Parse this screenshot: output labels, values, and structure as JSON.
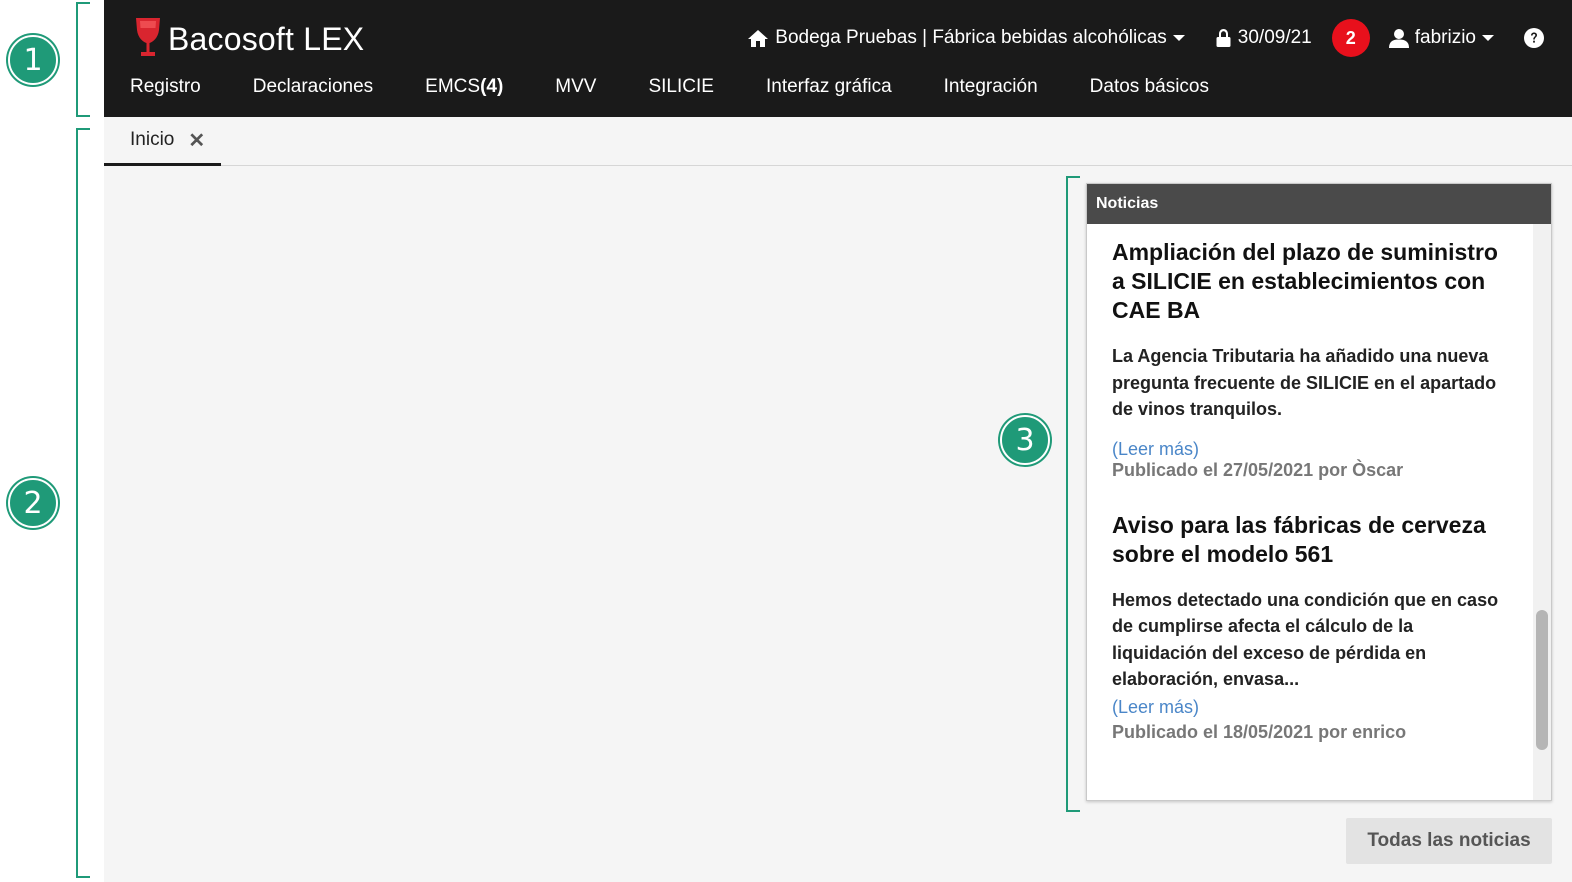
{
  "app": {
    "brand": "Bacosoft LEX"
  },
  "header": {
    "establishment": "Bodega Pruebas | Fábrica bebidas alcohólicas",
    "date": "30/09/21",
    "notifications_count": "2",
    "user": "fabrizio"
  },
  "nav": {
    "items": [
      "Registro",
      "Declaraciones",
      "EMCS",
      "MVV",
      "SILICIE",
      "Interfaz gráfica",
      "Integración",
      "Datos básicos"
    ],
    "emcs_count": "(4)"
  },
  "tabs": [
    {
      "label": "Inicio"
    }
  ],
  "news": {
    "title": "Noticias",
    "articles": [
      {
        "title": "Ampliación del plazo de suministro a SILICIE en establecimientos con CAE BA",
        "summary": "La Agencia Tributaria ha añadido una nueva pregunta frecuente de SILICIE en el apartado de vinos tranquilos.",
        "read_more": "(Leer más)",
        "published": "Publicado el 27/05/2021 por Òscar"
      },
      {
        "title": "Aviso para las fábricas de cerveza sobre el modelo 561",
        "summary": "Hemos detectado una condición que en caso de cumplirse afecta el cálculo de la liquidación del exceso de pérdida en elaboración, envasa...",
        "read_more": "(Leer más)",
        "published": "Publicado el 18/05/2021 por enrico"
      }
    ],
    "all_news_label": "Todas las noticias"
  },
  "callouts": [
    "1",
    "2",
    "3"
  ],
  "colors": {
    "topbar": "#1a1a1a",
    "badge": "#e8101c",
    "callout": "#1f9a78",
    "link": "#4a86c8",
    "news_header": "#4a4a4a"
  },
  "icons": [
    "wine-glass-logo-icon",
    "home-icon",
    "lock-icon",
    "user-icon",
    "help-icon",
    "close-icon",
    "chevron-down-icon"
  ]
}
